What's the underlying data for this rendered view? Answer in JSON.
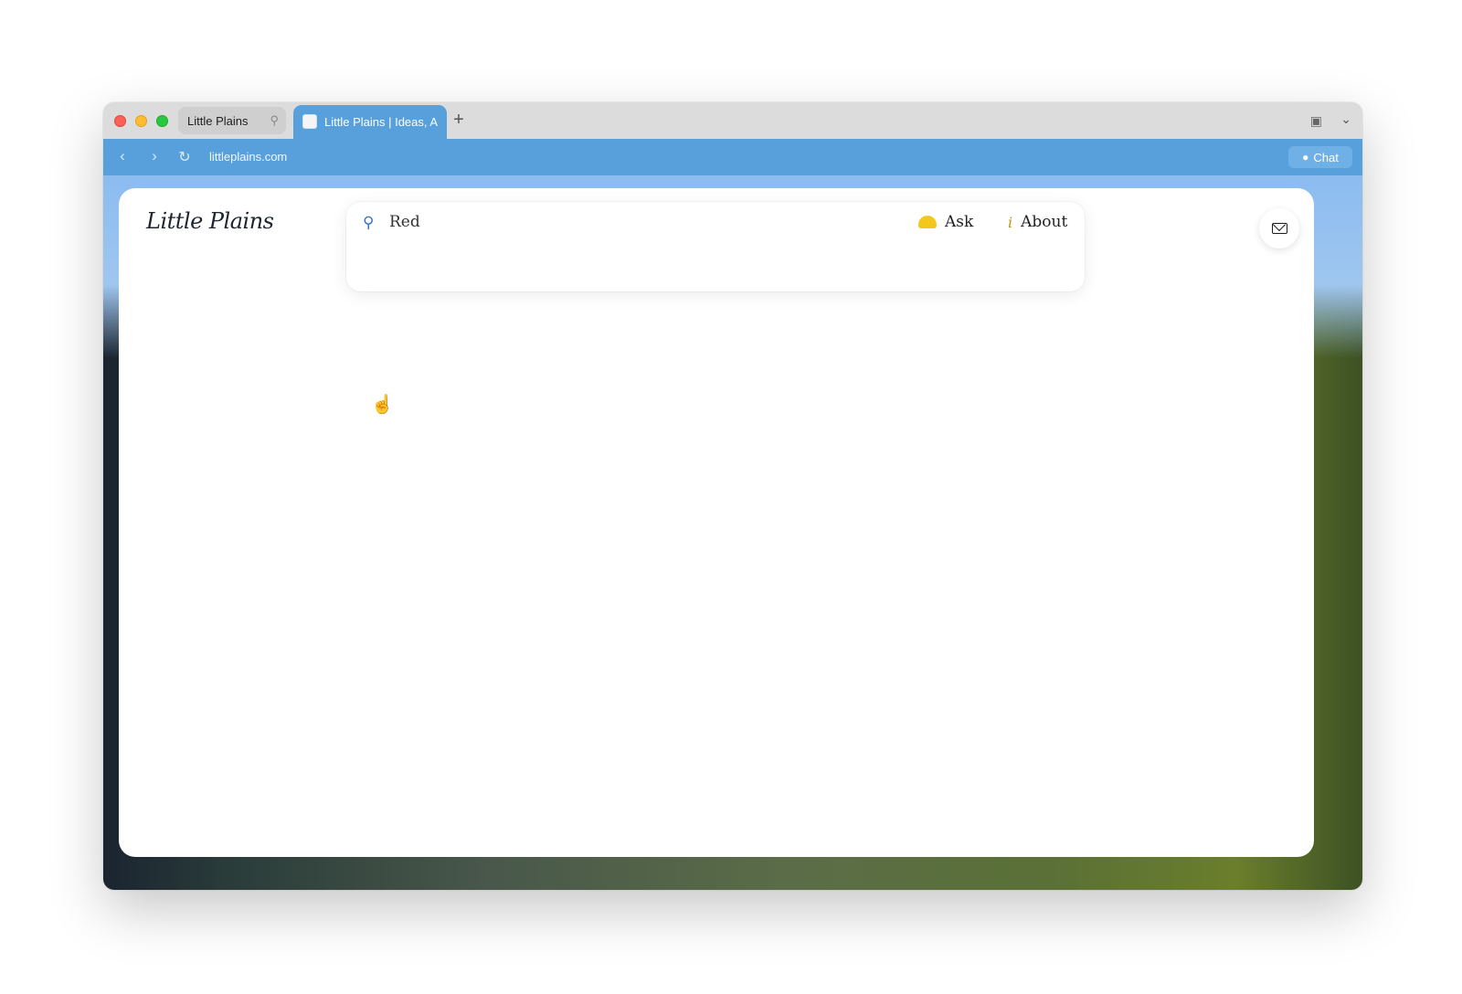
{
  "browser": {
    "tabs": [
      {
        "label": "Little Plains",
        "pinned": true
      },
      {
        "label": "Little Plains | Ideas, Ar",
        "active": true
      }
    ],
    "new_tab_icon": "+",
    "url": "littleplains.com",
    "chat_label": "Chat",
    "accent_color": "#57a0db"
  },
  "site": {
    "logo_text": "Little Plains",
    "search_value": "Red",
    "ask_label": "Ask",
    "about_label": "About",
    "about_icon_glyph": "i"
  },
  "icons": {
    "search": "search-icon",
    "bell": "bell-icon",
    "info": "info-icon",
    "mail": "mail-icon",
    "cursor": "hand-cursor-icon"
  }
}
